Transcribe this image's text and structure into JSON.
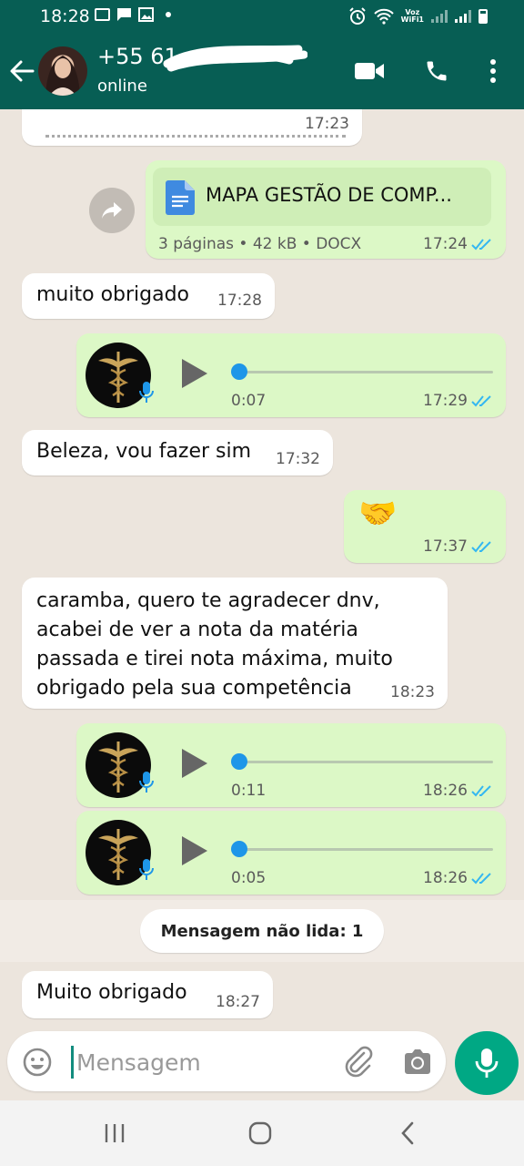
{
  "status_bar": {
    "time": "18:28",
    "network_label_top": "Voz",
    "network_label_bottom": "WiFi1",
    "icons": [
      "sim-icon",
      "message-icon",
      "image-icon",
      "alarm-icon",
      "wifi-icon",
      "signal-icon",
      "battery-icon"
    ]
  },
  "header": {
    "contact_name": "+55 61",
    "contact_status": "online",
    "accent_color": "#075e54"
  },
  "messages": {
    "top_partial": {
      "time": "17:23"
    },
    "document": {
      "name": "MAPA GESTÃO DE COMP...",
      "info": "3 páginas • 42 kB • DOCX",
      "time": "17:24"
    },
    "m1": {
      "text": "muito obrigado",
      "time": "17:28"
    },
    "voice1": {
      "duration": "0:07",
      "time": "17:29"
    },
    "m2": {
      "text": "Beleza, vou fazer sim",
      "time": "17:32"
    },
    "emoji_msg": {
      "emoji": "🤝",
      "time": "17:37"
    },
    "m3": {
      "line1": "caramba, quero te agradecer dnv,",
      "line2": "acabei de ver a nota da matéria",
      "line3": "passada e tirei nota máxima, muito",
      "line4": "obrigado pela sua competência",
      "time": "18:23"
    },
    "voice2": {
      "duration": "0:11",
      "time": "18:26"
    },
    "voice3": {
      "duration": "0:05",
      "time": "18:26"
    },
    "unread_label": "Mensagem não lida: 1",
    "m4": {
      "text": "Muito obrigado",
      "time": "18:27"
    }
  },
  "composer": {
    "placeholder": "Mensagem"
  },
  "colors": {
    "incoming_bubble": "#ffffff",
    "outgoing_bubble": "#dcf8c6",
    "read_ticks": "#34b7f1",
    "send_button": "#00a884"
  }
}
